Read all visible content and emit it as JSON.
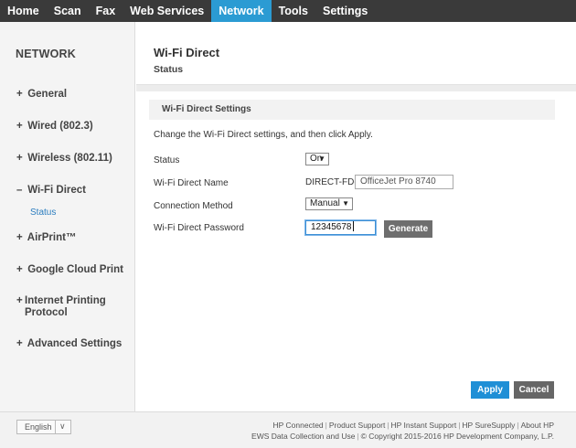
{
  "nav": {
    "tabs": [
      "Home",
      "Scan",
      "Fax",
      "Web Services",
      "Network",
      "Tools",
      "Settings"
    ],
    "active_index": 4
  },
  "sidebar": {
    "title": "NETWORK",
    "items": [
      {
        "sign": "+",
        "label": "General"
      },
      {
        "sign": "+",
        "label": "Wired (802.3)"
      },
      {
        "sign": "+",
        "label": "Wireless (802.11)"
      },
      {
        "sign": "–",
        "label": "Wi-Fi Direct"
      },
      {
        "sign": "+",
        "label": "AirPrint™"
      },
      {
        "sign": "+",
        "label": "Google Cloud Print"
      },
      {
        "sign": "+",
        "label": "Internet Printing\nProtocol"
      },
      {
        "sign": "+",
        "label": "Advanced Settings"
      }
    ],
    "subitem": "Status"
  },
  "main": {
    "title": "Wi-Fi Direct",
    "subtitle": "Status",
    "section_title": "Wi-Fi Direct Settings",
    "instructions": "Change the Wi-Fi Direct settings, and then click Apply.",
    "fields": {
      "status_label": "Status",
      "status_value": "On",
      "name_label": "Wi-Fi Direct Name",
      "name_prefix": "DIRECT-FD-HP",
      "name_value": "OfficeJet Pro 8740",
      "method_label": "Connection Method",
      "method_value": "Manual",
      "password_label": "Wi-Fi Direct Password",
      "password_value": "12345678"
    },
    "generate_label": "Generate",
    "apply_label": "Apply",
    "cancel_label": "Cancel"
  },
  "footer": {
    "language": "English",
    "links_line1": [
      "HP Connected",
      "Product Support",
      "HP Instant Support",
      "HP SureSupply",
      "About HP"
    ],
    "links_line2_link": "EWS Data Collection and Use",
    "copyright": "© Copyright 2015-2016 HP Development Company, L.P."
  },
  "colors": {
    "nav_bg": "#3a3a3a",
    "nav_active": "#2b9bd3",
    "apply": "#1f8fd6",
    "sublink": "#2b7dbf"
  }
}
